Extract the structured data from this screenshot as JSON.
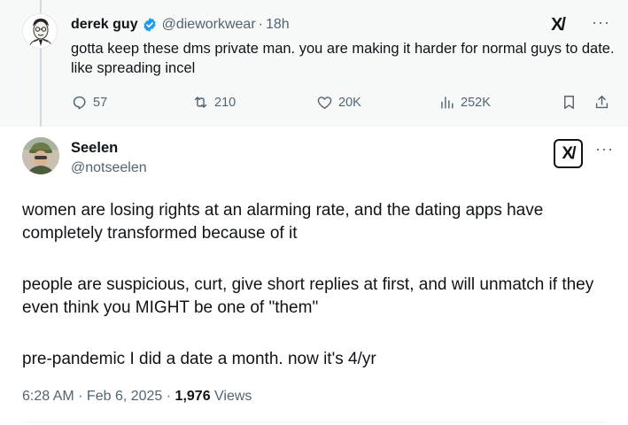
{
  "parent_tweet": {
    "name": "derek guy",
    "handle": "@dieworkwear",
    "separator": "·",
    "time": "18h",
    "grok_label": "X/",
    "more_label": "···",
    "text": "gotta keep these dms private man. you are making it harder for normal guys to date. like spreading incel",
    "actions": {
      "replies": "57",
      "reposts": "210",
      "likes": "20K",
      "views": "252K"
    },
    "colors": {
      "verified": "#1d9bf0",
      "background": "#f7f9f9"
    }
  },
  "main_tweet": {
    "name": "Seelen",
    "handle": "@notseelen",
    "grok_label": "X/",
    "more_label": "···",
    "paragraphs": [
      "women are losing rights at an alarming rate, and the dating apps have completely transformed because of it",
      "people are suspicious, curt, give short replies at first, and will unmatch if they even think you MIGHT be one of \"them\"",
      "pre-pandemic I did a date a month. now it's 4/yr"
    ],
    "meta": {
      "time": "6:28 AM",
      "separator1": " · ",
      "date": "Feb 6, 2025",
      "separator2": " · ",
      "views_count": "1,976",
      "views_label": " Views"
    }
  },
  "icons": {
    "reply": "reply-icon",
    "repost": "repost-icon",
    "like": "heart-icon",
    "views": "bar-chart-icon",
    "bookmark": "bookmark-icon",
    "share": "share-icon",
    "verified": "verified-badge-icon"
  }
}
